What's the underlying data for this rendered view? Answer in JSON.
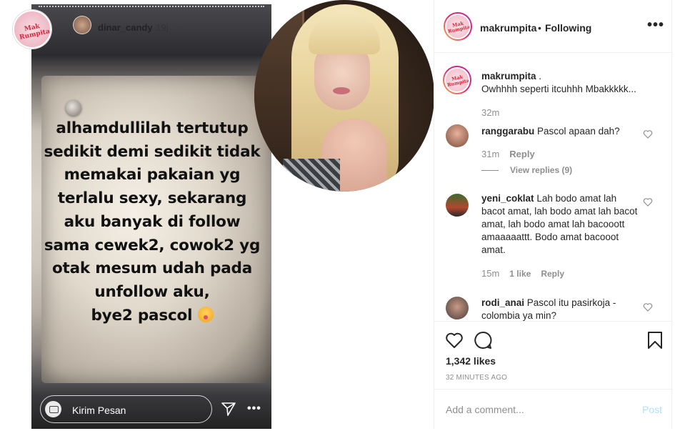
{
  "story": {
    "username": "dinar_candy",
    "time": "19j",
    "caption_lines": [
      "alhamdullilah tertutup",
      "sedikit demi sedikit tidak",
      "memakai pakaian yg",
      "terlalu sexy, sekarang",
      "aku banyak di follow",
      "sama cewek2, cowok2 yg",
      "otak mesum udah pada",
      "unfollow aku,",
      "bye2 pascol"
    ],
    "reply_placeholder": "Kirim Pesan",
    "more": "•••"
  },
  "header": {
    "username": "makrumpita",
    "separator": "•",
    "follow_status": "Following",
    "more": "•••",
    "avatar_logo_text": "Mak Rumpita"
  },
  "caption": {
    "username": "makrumpita",
    "text": ".",
    "text2": "Owhhhh seperti itcuhhh Mbakkkkk...",
    "time": "32m"
  },
  "comments": [
    {
      "username": "ranggarabu",
      "text": "Pascol apaan dah?",
      "time": "31m",
      "likes": "",
      "reply": "Reply",
      "view_replies": "View replies (9)"
    },
    {
      "username": "yeni_coklat",
      "text": "Lah bodo amat lah bacot amat, lah bodo amat lah bacot amat, lah bodo amat lah bacooott amaaaaattt. Bodo amat bacooot amat.",
      "time": "15m",
      "likes": "1 like",
      "reply": "Reply"
    },
    {
      "username": "rodi_anai",
      "text": "Pascol itu pasirkoja - colombia ya min?",
      "time": "",
      "likes": "",
      "reply": ""
    }
  ],
  "actions": {
    "likes": "1,342 likes",
    "time": "32 MINUTES AGO",
    "comment_placeholder": "Add a comment...",
    "post_label": "Post"
  },
  "colors": {
    "accent_link": "#b2dffc",
    "muted": "#8e8e8e",
    "text": "#262626"
  }
}
